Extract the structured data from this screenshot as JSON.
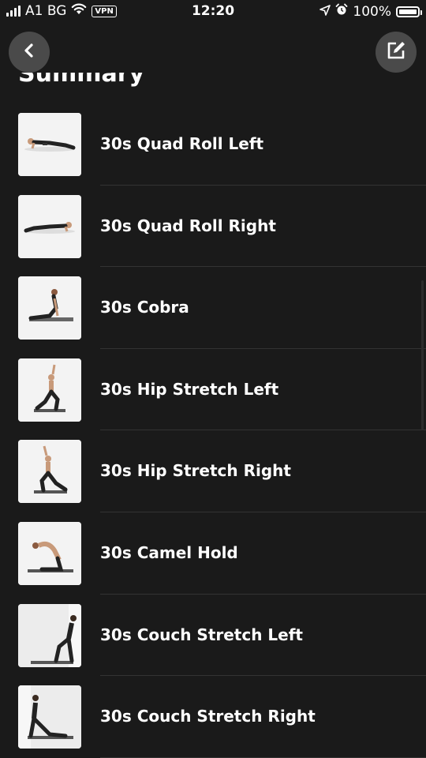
{
  "status_bar": {
    "carrier": "A1 BG",
    "vpn": "VPN",
    "time": "12:20",
    "battery": "100%"
  },
  "header": {
    "back_icon": "chevron-left-icon",
    "edit_icon": "edit-square-icon",
    "title": "Summary"
  },
  "exercises": [
    {
      "label": "30s Quad Roll Left",
      "pose": "plank-left"
    },
    {
      "label": "30s Quad Roll Right",
      "pose": "plank-right"
    },
    {
      "label": "30s Cobra",
      "pose": "cobra"
    },
    {
      "label": "30s Hip Stretch Left",
      "pose": "lunge-reach"
    },
    {
      "label": "30s Hip Stretch Right",
      "pose": "lunge-reach-2"
    },
    {
      "label": "30s Camel Hold",
      "pose": "camel"
    },
    {
      "label": "30s Couch Stretch Left",
      "pose": "couch"
    },
    {
      "label": "30s Couch Stretch Right",
      "pose": "couch-2"
    }
  ]
}
